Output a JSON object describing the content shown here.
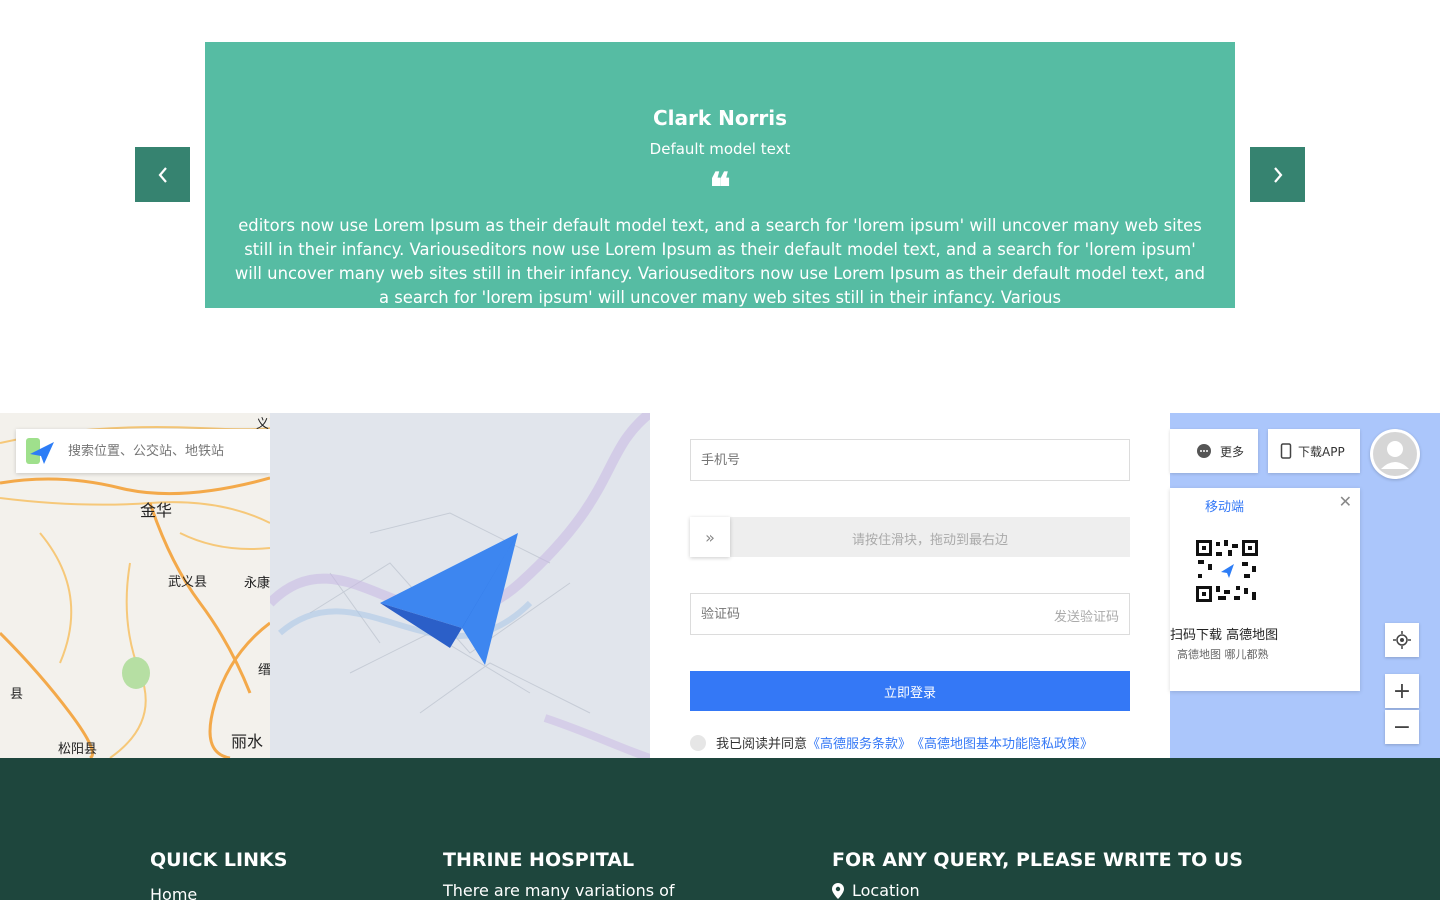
{
  "testimonial": {
    "name": "Clark Norris",
    "role": "Default model text",
    "quote_mark": "❝",
    "text": "editors now use Lorem Ipsum as their default model text, and a search for 'lorem ipsum' will uncover many web sites still in their infancy. Variouseditors now use Lorem Ipsum as their default model text, and a search for 'lorem ipsum' will uncover many web sites still in their infancy. Variouseditors now use Lorem Ipsum as their default model text, and a search for 'lorem ipsum' will uncover many web sites still in their infancy. Various",
    "prev_icon": "chevron-left-icon",
    "next_icon": "chevron-right-icon",
    "accent_color": "#56bca3",
    "nav_color": "#368370"
  },
  "map_left": {
    "search_placeholder": "搜索位置、公交站、地铁站",
    "labels": [
      "金华",
      "武义县",
      "永康",
      "松阳县",
      "丽水",
      "县",
      "义",
      "缙"
    ]
  },
  "login": {
    "phone_placeholder": "手机号",
    "slider_hint": "请按住滑块，拖动到最右边",
    "slider_icon": "double-chevron-right-icon",
    "code_placeholder": "验证码",
    "send_code": "发送验证码",
    "submit": "立即登录",
    "agree_prefix": "我已阅读并同意",
    "terms_link": "《高德服务条款》",
    "privacy_link": "《高德地图基本功能隐私政策》",
    "button_color": "#3478f6"
  },
  "map_right": {
    "more_label": "更多",
    "download_label": "下载APP",
    "qr_tab": "移动端",
    "qr_title": "扫码下载 高德地图",
    "qr_subtitle": "高德地图 哪儿都熟",
    "close_icon": "close-icon",
    "locate_icon": "locate-icon",
    "zoom_in": "+",
    "zoom_out": "−",
    "water_color": "#abc6fb"
  },
  "footer": {
    "quick_links_title": "QUICK LINKS",
    "quick_link_first": "Home",
    "hospital_title": "THRINE HOSPITAL",
    "hospital_text": "There are many variations of",
    "query_title": "FOR ANY QUERY, PLEASE WRITE TO US",
    "location_label": "Location",
    "background_color": "#1e463d"
  }
}
